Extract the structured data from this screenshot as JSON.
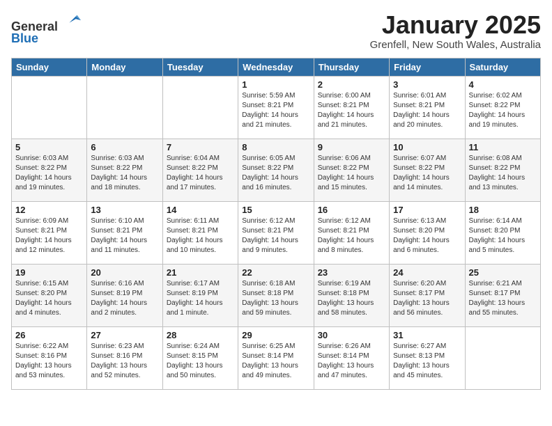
{
  "header": {
    "logo": {
      "line1": "General",
      "line2": "Blue"
    },
    "title": "January 2025",
    "location": "Grenfell, New South Wales, Australia"
  },
  "weekdays": [
    "Sunday",
    "Monday",
    "Tuesday",
    "Wednesday",
    "Thursday",
    "Friday",
    "Saturday"
  ],
  "weeks": [
    [
      {
        "day": null,
        "info": null
      },
      {
        "day": null,
        "info": null
      },
      {
        "day": null,
        "info": null
      },
      {
        "day": "1",
        "info": "Sunrise: 5:59 AM\nSunset: 8:21 PM\nDaylight: 14 hours\nand 21 minutes."
      },
      {
        "day": "2",
        "info": "Sunrise: 6:00 AM\nSunset: 8:21 PM\nDaylight: 14 hours\nand 21 minutes."
      },
      {
        "day": "3",
        "info": "Sunrise: 6:01 AM\nSunset: 8:21 PM\nDaylight: 14 hours\nand 20 minutes."
      },
      {
        "day": "4",
        "info": "Sunrise: 6:02 AM\nSunset: 8:22 PM\nDaylight: 14 hours\nand 19 minutes."
      }
    ],
    [
      {
        "day": "5",
        "info": "Sunrise: 6:03 AM\nSunset: 8:22 PM\nDaylight: 14 hours\nand 19 minutes."
      },
      {
        "day": "6",
        "info": "Sunrise: 6:03 AM\nSunset: 8:22 PM\nDaylight: 14 hours\nand 18 minutes."
      },
      {
        "day": "7",
        "info": "Sunrise: 6:04 AM\nSunset: 8:22 PM\nDaylight: 14 hours\nand 17 minutes."
      },
      {
        "day": "8",
        "info": "Sunrise: 6:05 AM\nSunset: 8:22 PM\nDaylight: 14 hours\nand 16 minutes."
      },
      {
        "day": "9",
        "info": "Sunrise: 6:06 AM\nSunset: 8:22 PM\nDaylight: 14 hours\nand 15 minutes."
      },
      {
        "day": "10",
        "info": "Sunrise: 6:07 AM\nSunset: 8:22 PM\nDaylight: 14 hours\nand 14 minutes."
      },
      {
        "day": "11",
        "info": "Sunrise: 6:08 AM\nSunset: 8:22 PM\nDaylight: 14 hours\nand 13 minutes."
      }
    ],
    [
      {
        "day": "12",
        "info": "Sunrise: 6:09 AM\nSunset: 8:21 PM\nDaylight: 14 hours\nand 12 minutes."
      },
      {
        "day": "13",
        "info": "Sunrise: 6:10 AM\nSunset: 8:21 PM\nDaylight: 14 hours\nand 11 minutes."
      },
      {
        "day": "14",
        "info": "Sunrise: 6:11 AM\nSunset: 8:21 PM\nDaylight: 14 hours\nand 10 minutes."
      },
      {
        "day": "15",
        "info": "Sunrise: 6:12 AM\nSunset: 8:21 PM\nDaylight: 14 hours\nand 9 minutes."
      },
      {
        "day": "16",
        "info": "Sunrise: 6:12 AM\nSunset: 8:21 PM\nDaylight: 14 hours\nand 8 minutes."
      },
      {
        "day": "17",
        "info": "Sunrise: 6:13 AM\nSunset: 8:20 PM\nDaylight: 14 hours\nand 6 minutes."
      },
      {
        "day": "18",
        "info": "Sunrise: 6:14 AM\nSunset: 8:20 PM\nDaylight: 14 hours\nand 5 minutes."
      }
    ],
    [
      {
        "day": "19",
        "info": "Sunrise: 6:15 AM\nSunset: 8:20 PM\nDaylight: 14 hours\nand 4 minutes."
      },
      {
        "day": "20",
        "info": "Sunrise: 6:16 AM\nSunset: 8:19 PM\nDaylight: 14 hours\nand 2 minutes."
      },
      {
        "day": "21",
        "info": "Sunrise: 6:17 AM\nSunset: 8:19 PM\nDaylight: 14 hours\nand 1 minute."
      },
      {
        "day": "22",
        "info": "Sunrise: 6:18 AM\nSunset: 8:18 PM\nDaylight: 13 hours\nand 59 minutes."
      },
      {
        "day": "23",
        "info": "Sunrise: 6:19 AM\nSunset: 8:18 PM\nDaylight: 13 hours\nand 58 minutes."
      },
      {
        "day": "24",
        "info": "Sunrise: 6:20 AM\nSunset: 8:17 PM\nDaylight: 13 hours\nand 56 minutes."
      },
      {
        "day": "25",
        "info": "Sunrise: 6:21 AM\nSunset: 8:17 PM\nDaylight: 13 hours\nand 55 minutes."
      }
    ],
    [
      {
        "day": "26",
        "info": "Sunrise: 6:22 AM\nSunset: 8:16 PM\nDaylight: 13 hours\nand 53 minutes."
      },
      {
        "day": "27",
        "info": "Sunrise: 6:23 AM\nSunset: 8:16 PM\nDaylight: 13 hours\nand 52 minutes."
      },
      {
        "day": "28",
        "info": "Sunrise: 6:24 AM\nSunset: 8:15 PM\nDaylight: 13 hours\nand 50 minutes."
      },
      {
        "day": "29",
        "info": "Sunrise: 6:25 AM\nSunset: 8:14 PM\nDaylight: 13 hours\nand 49 minutes."
      },
      {
        "day": "30",
        "info": "Sunrise: 6:26 AM\nSunset: 8:14 PM\nDaylight: 13 hours\nand 47 minutes."
      },
      {
        "day": "31",
        "info": "Sunrise: 6:27 AM\nSunset: 8:13 PM\nDaylight: 13 hours\nand 45 minutes."
      },
      {
        "day": null,
        "info": null
      }
    ]
  ]
}
